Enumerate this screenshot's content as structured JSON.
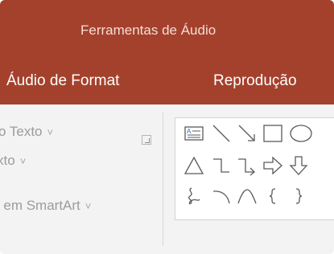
{
  "ribbon": {
    "context_title": "Ferramentas de Áudio",
    "tabs": [
      {
        "label": "Áudio de Format"
      },
      {
        "label": "Reprodução"
      }
    ]
  },
  "group": {
    "commands": [
      {
        "label": "o Texto"
      },
      {
        "label": "xto"
      },
      {
        "label": "r em SmartArt"
      }
    ]
  },
  "shapes_gallery": {
    "rows": [
      [
        "text-box",
        "line",
        "arrow-line",
        "rectangle",
        "oval"
      ],
      [
        "triangle",
        "elbow-connector",
        "elbow-arrow-connector",
        "right-arrow",
        "down-arrow"
      ],
      [
        "freeform-scribble",
        "arc",
        "curve",
        "left-brace",
        "right-brace"
      ]
    ]
  },
  "colors": {
    "ribbon_red": "#a4412c",
    "ribbon_body": "#f3f3f3",
    "shape_stroke": "#5a5a5a",
    "text_box_accent": "#2b6cc4"
  }
}
